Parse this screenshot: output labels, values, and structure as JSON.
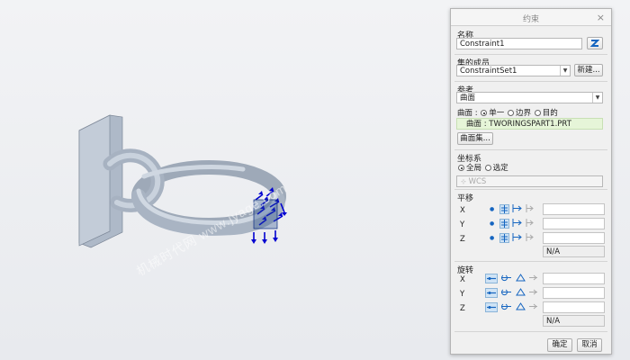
{
  "watermark": "机械时代网 www.jyage.com",
  "dialog": {
    "title": "约束",
    "close_glyph": "×",
    "name": {
      "label": "名称",
      "value": "Constraint1"
    },
    "set": {
      "label": "集的成员",
      "value": "ConstraintSet1",
      "new_button": "新建..."
    },
    "reference": {
      "label": "参考",
      "type_value": "曲面",
      "surface_label": "曲面 :",
      "options": [
        "单一",
        "边界",
        "目的"
      ],
      "selected_item": "曲面 : TWORINGSPART1.PRT",
      "collect_button": "曲面集..."
    },
    "csys": {
      "label": "坐标系",
      "options": [
        "全局",
        "选定"
      ],
      "field": "WCS"
    },
    "translation": {
      "label": "平移",
      "rows": [
        "X",
        "Y",
        "Z"
      ],
      "na": "N/A"
    },
    "rotation": {
      "label": "旋转",
      "rows": [
        "X",
        "Y",
        "Z"
      ],
      "na": "N/A"
    },
    "ok_button": "确定",
    "cancel_button": "取消"
  },
  "colors": {
    "accent": "#1565c0",
    "constraint_arrows": "#0000d0",
    "model": "#b7c2d0"
  }
}
